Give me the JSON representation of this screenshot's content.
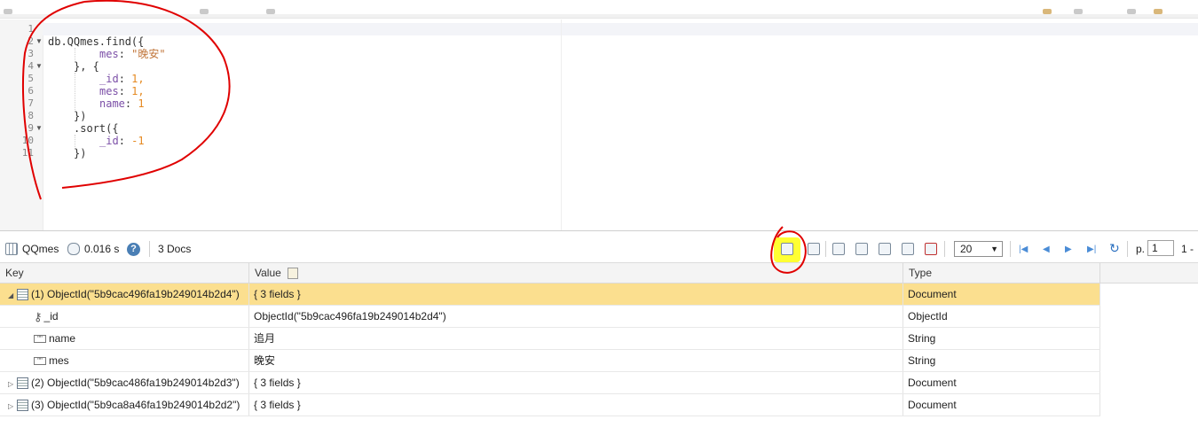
{
  "editor": {
    "line_numbers": [
      "1",
      "2",
      "3",
      "4",
      "5",
      "6",
      "7",
      "8",
      "9",
      "10",
      "11"
    ],
    "lines": [
      {
        "plain": ""
      },
      {
        "a": "db.QQmes.find({"
      },
      {
        "key": "mes",
        "str": "\"晚安\""
      },
      {
        "a": "}, {"
      },
      {
        "key": "_id",
        "num": "1,"
      },
      {
        "key": "mes",
        "num": "1,"
      },
      {
        "key": "name",
        "num": "1"
      },
      {
        "a": "})"
      },
      {
        "a": ".sort({"
      },
      {
        "key": "_id",
        "num": "-1"
      },
      {
        "a": "})"
      }
    ]
  },
  "toolbar": {
    "collection": "QQmes",
    "time": "0.016 s",
    "docs": "3 Docs",
    "page_size": "20",
    "page_label": "p.",
    "page_value": "1",
    "range": "1 -"
  },
  "table": {
    "headers": {
      "key": "Key",
      "value": "Value",
      "type": "Type"
    },
    "rows": [
      {
        "key": "(1) ObjectId(\"5b9cac496fa19b249014b2d4\")",
        "value": "{ 3 fields }",
        "type": "Document"
      },
      {
        "key": "_id",
        "value": "ObjectId(\"5b9cac496fa19b249014b2d4\")",
        "type": "ObjectId"
      },
      {
        "key": "name",
        "value": "追月",
        "type": "String"
      },
      {
        "key": "mes",
        "value": "晚安",
        "type": "String"
      },
      {
        "key": "(2) ObjectId(\"5b9cac486fa19b249014b2d3\")",
        "value": "{ 3 fields }",
        "type": "Document"
      },
      {
        "key": "(3) ObjectId(\"5b9ca8a46fa19b249014b2d2\")",
        "value": "{ 3 fields }",
        "type": "Document"
      }
    ]
  },
  "colors": {
    "selected_row": "#fbdf8f",
    "highlight": "#ffff33",
    "annotation": "#e00000"
  }
}
